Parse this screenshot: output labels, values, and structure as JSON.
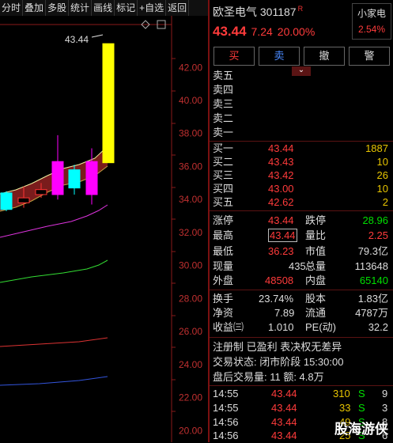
{
  "toolbar": [
    "分时",
    "叠加",
    "多股",
    "统计",
    "画线",
    "标记",
    "+自选",
    "返回"
  ],
  "chart_data": {
    "type": "candlestick",
    "y_ticks": [
      "42.00",
      "40.00",
      "38.00",
      "36.00",
      "34.00",
      "32.00",
      "30.00",
      "28.00",
      "26.00",
      "24.00",
      "22.00",
      "20.00"
    ],
    "ylim": [
      19.3,
      44.6
    ],
    "high_annotation": "43.44",
    "candles": [
      {
        "o": 33.4,
        "c": 34.4,
        "h": 34.5,
        "l": 33.3,
        "color": "#00ffff"
      },
      {
        "o": 33.8,
        "c": 34.1,
        "h": 34.8,
        "l": 33.5,
        "color": "#000000"
      },
      {
        "o": 34.3,
        "c": 34.6,
        "h": 35.0,
        "l": 34.1,
        "color": "#000000"
      },
      {
        "o": 34.3,
        "c": 36.3,
        "h": 37.9,
        "l": 34.0,
        "color": "#ff00ff"
      },
      {
        "o": 35.8,
        "c": 34.7,
        "h": 36.1,
        "l": 34.3,
        "color": "#00ffff"
      },
      {
        "o": 34.3,
        "c": 36.3,
        "h": 37.1,
        "l": 33.7,
        "color": "#ff00ff"
      },
      {
        "o": 36.23,
        "c": 43.44,
        "h": 43.44,
        "l": 36.23,
        "color": "#ffff00"
      }
    ]
  },
  "stock": {
    "name": "欧圣电气",
    "code": "301187",
    "badge": "R",
    "price": "43.44",
    "change": "7.24",
    "pct": "20.00%",
    "sector_name": "小家电",
    "sector_pct": "2.54%"
  },
  "buttons": {
    "buy": "买",
    "sell": "卖",
    "cancel": "撤",
    "alert": "警"
  },
  "collapse_glyph": "⌄",
  "sells": [
    "卖五",
    "卖四",
    "卖三",
    "卖二",
    "卖一"
  ],
  "buys": [
    {
      "label": "买一",
      "price": "43.44",
      "vol": "1887"
    },
    {
      "label": "买二",
      "price": "43.43",
      "vol": "10"
    },
    {
      "label": "买三",
      "price": "43.42",
      "vol": "26"
    },
    {
      "label": "买四",
      "price": "43.00",
      "vol": "10"
    },
    {
      "label": "买五",
      "price": "42.62",
      "vol": "2"
    }
  ],
  "stats": {
    "zhangting_l": "涨停",
    "zhangting_v": "43.44",
    "dieting_l": "跌停",
    "dieting_v": "28.96",
    "high_l": "最高",
    "high_v": "43.44",
    "liangbi_l": "量比",
    "liangbi_v": "2.25",
    "low_l": "最低",
    "low_v": "36.23",
    "shizhi_l": "市值",
    "shizhi_v": "79.3亿",
    "xianliang_l": "现量",
    "xianliang_v": "435",
    "zongliang_l": "总量",
    "zongliang_v": "113648",
    "waipan_l": "外盘",
    "waipan_v": "48508",
    "neipan_l": "内盘",
    "neipan_v": "65140",
    "huanshou_l": "换手",
    "huanshou_v": "23.74%",
    "guben_l": "股本",
    "guben_v": "1.83亿",
    "jingzi_l": "净资",
    "jingzi_v": "7.89",
    "liutong_l": "流通",
    "liutong_v": "4787万",
    "shouyi_l": "收益㈢",
    "shouyi_v": "1.010",
    "pe_l": "PE(动)",
    "pe_v": "32.2"
  },
  "info": {
    "tags": "注册制 已盈利 表决权无差异",
    "status": "交易状态: 闭市阶段 15:30:00",
    "after": "盘后交易量: 11  额: 4.8万"
  },
  "ticks": [
    {
      "time": "14:55",
      "price": "43.44",
      "vol": "310",
      "side": "S",
      "n": "9"
    },
    {
      "time": "14:55",
      "price": "43.44",
      "vol": "33",
      "side": "S",
      "n": "3"
    },
    {
      "time": "14:56",
      "price": "43.44",
      "vol": "49",
      "side": "S",
      "n": "8"
    },
    {
      "time": "14:56",
      "price": "43.44",
      "vol": "25",
      "side": "S",
      "n": "6"
    }
  ],
  "watermark": "股海游侠"
}
